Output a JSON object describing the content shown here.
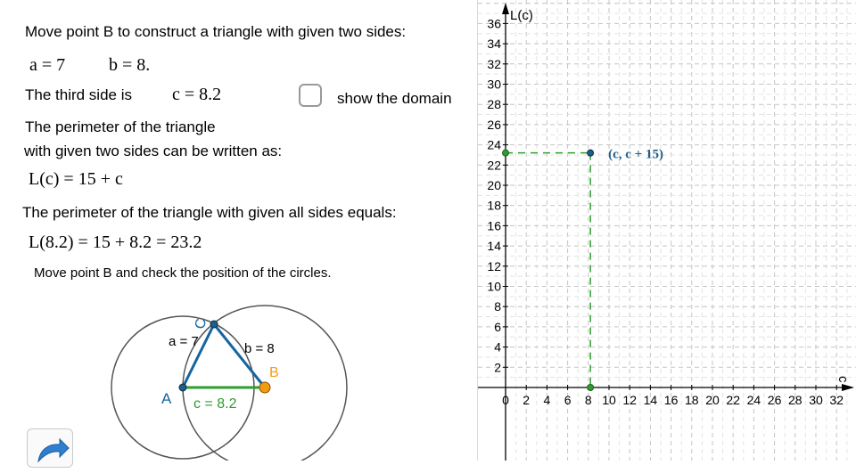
{
  "instructions": {
    "move_b": "Move point B to construct a triangle with given two sides:",
    "a_eq": "a = 7",
    "b_eq": "b = 8.",
    "third_side_label": "The third side is",
    "c_eq": "c = 8.2",
    "show_domain_label": "show the domain",
    "perimeter_line1": "The perimeter of the triangle",
    "perimeter_line2": "with given two sides can be written as:",
    "perimeter_formula": "L(c) = 15 + c",
    "all_sides_label": "The perimeter of the triangle with given all sides equals:",
    "perimeter_value": "L(8.2) = 15 + 8.2 = 23.2",
    "check_circles": "Move point B and check the position of the circles."
  },
  "construction": {
    "point_a": "A",
    "point_b": "B",
    "point_c": "C",
    "label_a": "a = 7",
    "label_b": "b = 8",
    "label_c": "c = 8.2",
    "colors": {
      "side": "#1565a0",
      "base": "#2e9e2e",
      "point_b": "#f39c12",
      "circle": "#555555"
    }
  },
  "checkbox": {
    "checked": false
  },
  "graph": {
    "y_axis_label": "L(c)",
    "x_axis_label": "c",
    "point_label": "(c, c + 15)",
    "x_ticks": [
      "0",
      "2",
      "4",
      "6",
      "8",
      "10",
      "12",
      "14",
      "16",
      "18",
      "20",
      "22",
      "24",
      "26",
      "28",
      "30",
      "32"
    ],
    "y_ticks": [
      "2",
      "4",
      "6",
      "8",
      "10",
      "12",
      "14",
      "16",
      "18",
      "20",
      "22",
      "24",
      "26",
      "28",
      "30",
      "32",
      "34",
      "36"
    ],
    "point": {
      "c": 8.2,
      "L": 23.2
    },
    "colors": {
      "guide": "#2e9e2e",
      "point": "#1f5f8b",
      "label": "#1f5f8b"
    }
  }
}
